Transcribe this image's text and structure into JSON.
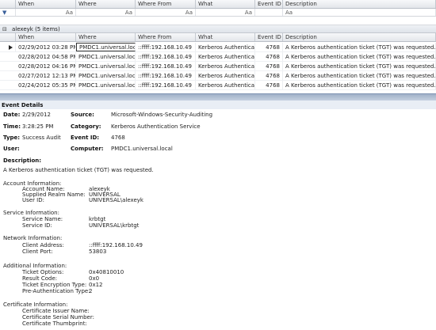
{
  "columns": {
    "when": "When",
    "where": "Where",
    "where_from": "Where From",
    "what": "What",
    "event_id": "Event ID",
    "description": "Description"
  },
  "filter_row": {
    "funnel": "▼",
    "glyph": "Aa"
  },
  "group": {
    "toggle": "⊟",
    "label": "alexeyk (5 items)"
  },
  "rows": [
    {
      "when": "02/29/2012 03:28 PM",
      "where": "PMDC1.universal.local",
      "where_from": "::ffff:192.168.10.49",
      "what": "Kerberos Authenticatio",
      "event_id": "4768",
      "description": "A Kerberos authentication ticket (TGT) was requested."
    },
    {
      "when": "02/28/2012 04:58 PM",
      "where": "PMDC1.universal.local",
      "where_from": "::ffff:192.168.10.49",
      "what": "Kerberos Authenticatio",
      "event_id": "4768",
      "description": "A Kerberos authentication ticket (TGT) was requested."
    },
    {
      "when": "02/28/2012 04:16 PM",
      "where": "PMDC1.universal.local",
      "where_from": "::ffff:192.168.10.49",
      "what": "Kerberos Authenticatio",
      "event_id": "4768",
      "description": "A Kerberos authentication ticket (TGT) was requested."
    },
    {
      "when": "02/27/2012 12:13 PM",
      "where": "PMDC1.universal.local",
      "where_from": "::ffff:192.168.10.49",
      "what": "Kerberos Authenticatio",
      "event_id": "4768",
      "description": "A Kerberos authentication ticket (TGT) was requested."
    },
    {
      "when": "02/24/2012 05:35 PM",
      "where": "PMDC1.universal.local",
      "where_from": "::ffff:192.168.10.49",
      "what": "Kerberos Authenticatio",
      "event_id": "4768",
      "description": "A Kerberos authentication ticket (TGT) was requested."
    }
  ],
  "details": {
    "title": "Event Details",
    "date_label": "Date:",
    "date": "2/29/2012",
    "time_label": "Time:",
    "time": "3:28:25 PM",
    "type_label": "Type:",
    "type": "Success Audit",
    "user_label": "User:",
    "user": "",
    "source_label": "Source:",
    "source": "Microsoft-Windows-Security-Auditing",
    "category_label": "Category:",
    "category": "Kerberos Authentication Service",
    "event_id_label": "Event ID:",
    "event_id": "4768",
    "computer_label": "Computer:",
    "computer": "PMDC1.universal.local",
    "description_label": "Description:",
    "description": "A Kerberos authentication ticket (TGT) was requested.",
    "account_header": "Account Information:",
    "account_name_label": "Account Name:",
    "account_name": "alexeyk",
    "realm_label": "Supplied Realm Name:",
    "realm": "UNIVERSAL",
    "user_id_label": "User ID:",
    "user_id": "UNIVERSAL\\alexeyk",
    "service_header": "Service Information:",
    "service_name_label": "Service Name:",
    "service_name": "krbtgt",
    "service_id_label": "Service ID:",
    "service_id": "UNIVERSAL\\krbtgt",
    "network_header": "Network Information:",
    "client_address_label": "Client Address:",
    "client_address": "::ffff:192.168.10.49",
    "client_port_label": "Client Port:",
    "client_port": "53803",
    "additional_header": "Additional Information:",
    "ticket_options_label": "Ticket Options:",
    "ticket_options": "0x40810010",
    "result_code_label": "Result Code:",
    "result_code": "0x0",
    "encryption_label": "Ticket Encryption Type:",
    "encryption": "0x12",
    "preauth_label": "Pre-Authentication Type:",
    "preauth": "2",
    "cert_header": "Certificate Information:",
    "cert_issuer_label": "Certificate Issuer Name:",
    "cert_serial_label": "Certificate Serial Number:",
    "cert_thumb_label": "Certificate Thumbprint:"
  }
}
